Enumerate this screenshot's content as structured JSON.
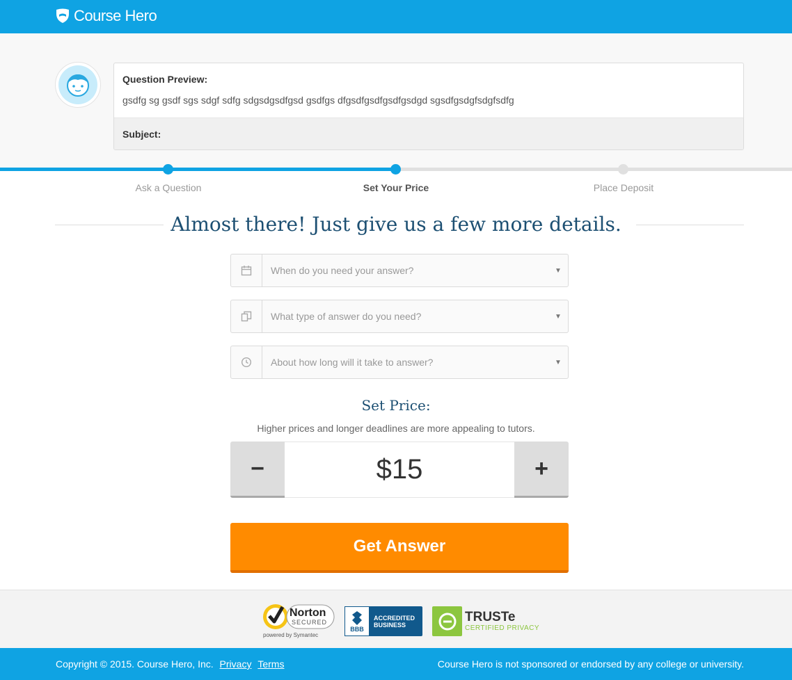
{
  "header": {
    "brand": "Course Hero"
  },
  "question": {
    "label": "Question Preview:",
    "text": "gsdfg sg gsdf sgs sdgf sdfg sdgsdgsdfgsd gsdfgs dfgsdfgsdfgsdfgsdgd sgsdfgsdgfsdgfsdfg",
    "subject_label": "Subject:"
  },
  "steps": {
    "progress_fraction": 0.5,
    "items": [
      {
        "label": "Ask a Question",
        "state": "done"
      },
      {
        "label": "Set Your Price",
        "state": "active"
      },
      {
        "label": "Place Deposit",
        "state": "pending"
      }
    ]
  },
  "headline": "Almost there! Just give us a few more details.",
  "form": {
    "deadline_placeholder": "When do you need your answer?",
    "type_placeholder": "What type of answer do you need?",
    "duration_placeholder": "About how long will it take to answer?"
  },
  "price": {
    "title": "Set Price:",
    "subtitle": "Higher prices and longer deadlines are more appealing to tutors.",
    "minus": "−",
    "value": "$15",
    "plus": "+"
  },
  "cta": {
    "label": "Get Answer"
  },
  "badges": {
    "norton_name": "Norton",
    "norton_secured": "SECURED",
    "norton_powered": "powered by Symantec",
    "bbb_letters": "BBB",
    "bbb_line1": "ACCREDITED",
    "bbb_line2": "BUSINESS",
    "truste_name": "TRUSTe",
    "truste_sub": "CERTIFIED PRIVACY"
  },
  "footer": {
    "copyright": "Copyright © 2015. Course Hero, Inc.",
    "privacy": "Privacy",
    "terms": "Terms",
    "disclaimer": "Course Hero is not sponsored or endorsed by any college or university."
  },
  "colors": {
    "brand_blue": "#0fa3e3",
    "heading_navy": "#1c4f72",
    "cta_orange": "#ff8b00",
    "truste_green": "#8cc63f",
    "bbb_blue": "#11598c"
  },
  "icons": [
    "course-hero-shield-icon",
    "calendar-icon",
    "answer-type-icon",
    "clock-icon",
    "dropdown-caret-icon"
  ]
}
